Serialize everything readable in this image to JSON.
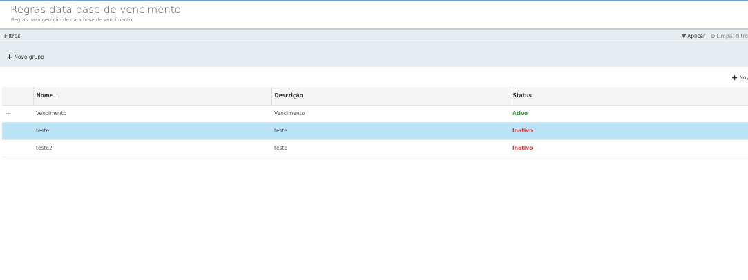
{
  "header": {
    "title": "Regras data base de vencimento",
    "subtitle": "Regras para geração de data base de vencimento"
  },
  "filters": {
    "label": "Filtros",
    "apply": "Aplicar",
    "clear": "Limpar filtro",
    "new_group": "Novo grupo"
  },
  "toolbar": {
    "new": "Novo"
  },
  "table": {
    "columns": [
      "Nome",
      "Descrição",
      "Status"
    ],
    "sort_indicator": "↑",
    "rows": [
      {
        "nome": "Vencimento",
        "descricao": "Vencimento",
        "status": "Ativo",
        "expander": "+"
      },
      {
        "nome": "teste",
        "descricao": "teste",
        "status": "Inativo",
        "selected": true
      },
      {
        "nome": "teste2",
        "descricao": "teste",
        "status": "Inativo"
      }
    ]
  },
  "colors": {
    "accent": "#6a9fc7",
    "selected_row": "#bde3f7",
    "active": "#3a9a3a",
    "inactive": "#d83a3a",
    "filter_bg": "#e5eff1"
  }
}
